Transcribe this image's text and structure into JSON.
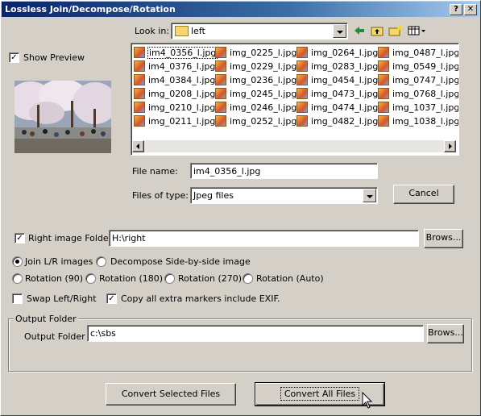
{
  "window": {
    "title": "Lossless Join/Decompose/Rotation",
    "help_btn": "?",
    "close_btn": "✕"
  },
  "lookin": {
    "label": "Look in:",
    "value": "left"
  },
  "preview": {
    "checkbox_label": "Show Preview",
    "checked": true
  },
  "files": [
    [
      "im4_0356_l.jpg",
      "img_0225_l.jpg",
      "img_0264_l.jpg",
      "img_0487_l.jpg"
    ],
    [
      "im4_0376_l.jpg",
      "img_0229_l.jpg",
      "img_0283_l.jpg",
      "img_0549_l.jpg"
    ],
    [
      "im4_0384_l.jpg",
      "img_0236_l.jpg",
      "img_0454_l.jpg",
      "img_0747_l.jpg"
    ],
    [
      "img_0208_l.jpg",
      "img_0245_l.jpg",
      "img_0473_l.jpg",
      "img_0768_l.jpg"
    ],
    [
      "img_0210_l.jpg",
      "img_0246_l.jpg",
      "img_0474_l.jpg",
      "img_1037_l.jpg"
    ],
    [
      "img_0211_l.jpg",
      "img_0252_l.jpg",
      "img_0482_l.jpg",
      "img_1038_l.jpg"
    ]
  ],
  "filename": {
    "label": "File name:",
    "value": "im4_0356_l.jpg"
  },
  "filetype": {
    "label": "Files of type:",
    "value": "Jpeg files"
  },
  "cancel_label": "Cancel",
  "right_folder": {
    "label": "Right image Folder :",
    "value": "H:\\right",
    "checked": true,
    "browse": "Brows..."
  },
  "modes": {
    "join": "Join L/R images",
    "decompose": "Decompose Side-by-side image",
    "rot90": "Rotation (90)",
    "rot180": "Rotation (180)",
    "rot270": "Rotation (270)",
    "rotauto": "Rotation (Auto)",
    "selected": "join"
  },
  "swap": {
    "label": "Swap Left/Right",
    "checked": false
  },
  "exif": {
    "label": "Copy all extra markers include EXIF.",
    "checked": true
  },
  "output": {
    "group_label": "Output Folder",
    "label": "Output Folder :",
    "value": "c:\\sbs",
    "browse": "Brows..."
  },
  "buttons": {
    "convert_selected": "Convert Selected Files",
    "convert_all": "Convert All Files"
  }
}
